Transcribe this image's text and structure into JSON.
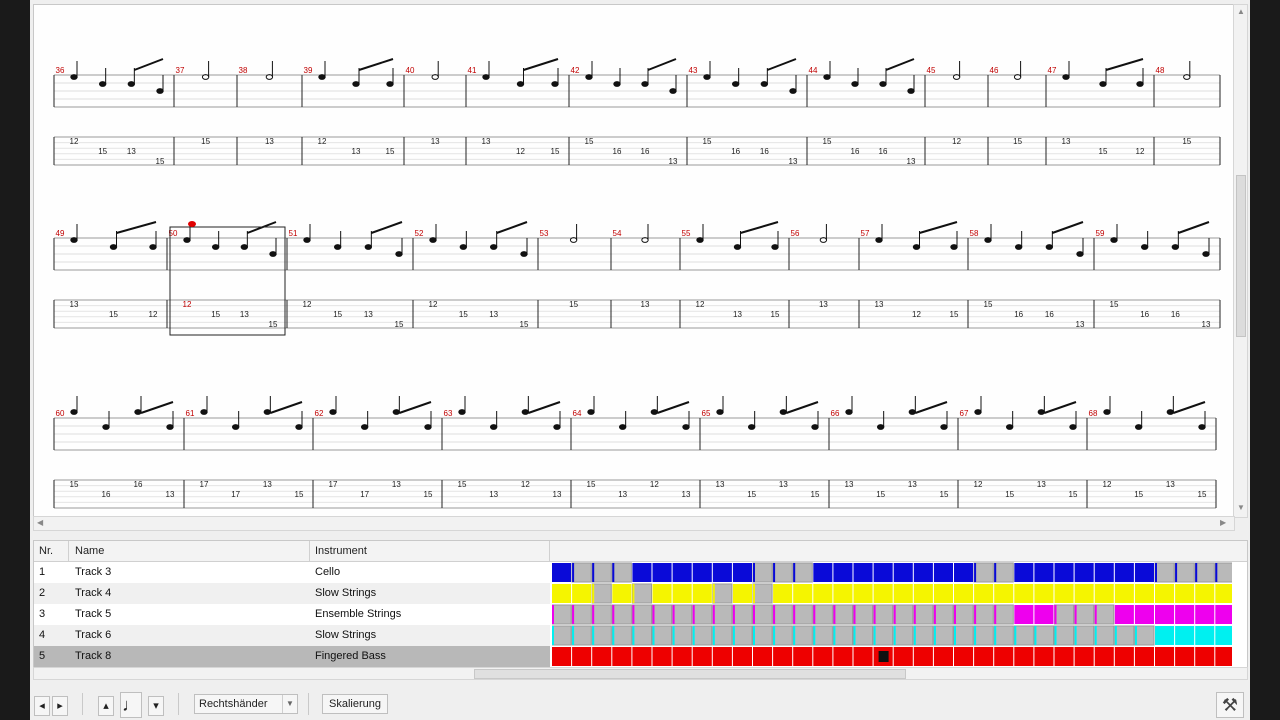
{
  "score": {
    "bar_numbers_row1": [
      "36",
      "37",
      "38",
      "39",
      "40",
      "41",
      "42",
      "43",
      "44",
      "45",
      "46",
      "47",
      "48"
    ],
    "bar_numbers_row2": [
      "49",
      "50",
      "51",
      "52",
      "53",
      "54",
      "55",
      "56",
      "57",
      "58",
      "59"
    ],
    "bar_numbers_row3": [
      "60",
      "61",
      "62",
      "63",
      "64",
      "65",
      "66",
      "67",
      "68"
    ],
    "tab_row1": [
      [
        "12",
        "15",
        "13",
        "15"
      ],
      [
        "15"
      ],
      [
        "13"
      ],
      [
        "12",
        "13",
        "15"
      ],
      [
        "13"
      ],
      [
        "13",
        "12",
        "15"
      ],
      [
        "15",
        "16",
        "16",
        "13"
      ],
      [
        "15",
        "16",
        "16",
        "13"
      ],
      [
        "15",
        "16",
        "16",
        "13"
      ],
      [
        "12"
      ],
      [
        "15"
      ],
      [
        "13",
        "15",
        "12"
      ],
      [
        "15"
      ]
    ],
    "tab_row2": [
      [
        "13",
        "15",
        "12"
      ],
      [
        "12",
        "15",
        "13",
        "15"
      ],
      [
        "12",
        "15",
        "13",
        "15"
      ],
      [
        "12",
        "15",
        "13",
        "15"
      ],
      [
        "15"
      ],
      [
        "13"
      ],
      [
        "12",
        "13",
        "15"
      ],
      [
        "13"
      ],
      [
        "13",
        "12",
        "15"
      ],
      [
        "15",
        "16",
        "16",
        "13"
      ],
      [
        "15",
        "16",
        "16",
        "13"
      ]
    ],
    "tab_row3": [
      [
        "15",
        "16",
        "16",
        "13"
      ],
      [
        "17",
        "17",
        "13",
        "15"
      ],
      [
        "17",
        "17",
        "13",
        "15"
      ],
      [
        "15",
        "13",
        "12",
        "13"
      ],
      [
        "15",
        "13",
        "12",
        "13"
      ],
      [
        "13",
        "15",
        "13",
        "15"
      ],
      [
        "13",
        "15",
        "13",
        "15"
      ],
      [
        "12",
        "15",
        "13",
        "15"
      ],
      [
        "12",
        "15",
        "13",
        "15"
      ]
    ]
  },
  "tracks": {
    "headers": {
      "nr": "Nr.",
      "name": "Name",
      "instrument": "Instrument"
    },
    "rows": [
      {
        "nr": "1",
        "name": "Track 3",
        "instrument": "Cello",
        "color": "#0a0ad8"
      },
      {
        "nr": "2",
        "name": "Track 4",
        "instrument": "Slow Strings",
        "color": "#f5f500"
      },
      {
        "nr": "3",
        "name": "Track 5",
        "instrument": "Ensemble Strings",
        "color": "#ee00ee"
      },
      {
        "nr": "4",
        "name": "Track 6",
        "instrument": "Slow Strings",
        "color": "#00f0f0"
      },
      {
        "nr": "5",
        "name": "Track 8",
        "instrument": "Fingered Bass",
        "color": "#ee0000"
      }
    ],
    "selected_row": "5"
  },
  "toolbar": {
    "hand_select": "Rechtshänder",
    "scale_button": "Skalierung"
  },
  "icons": [
    "left-arrow-icon",
    "right-arrow-icon",
    "up-arrow-icon",
    "quarter-note-icon",
    "down-arrow-icon",
    "hammer-icon"
  ]
}
